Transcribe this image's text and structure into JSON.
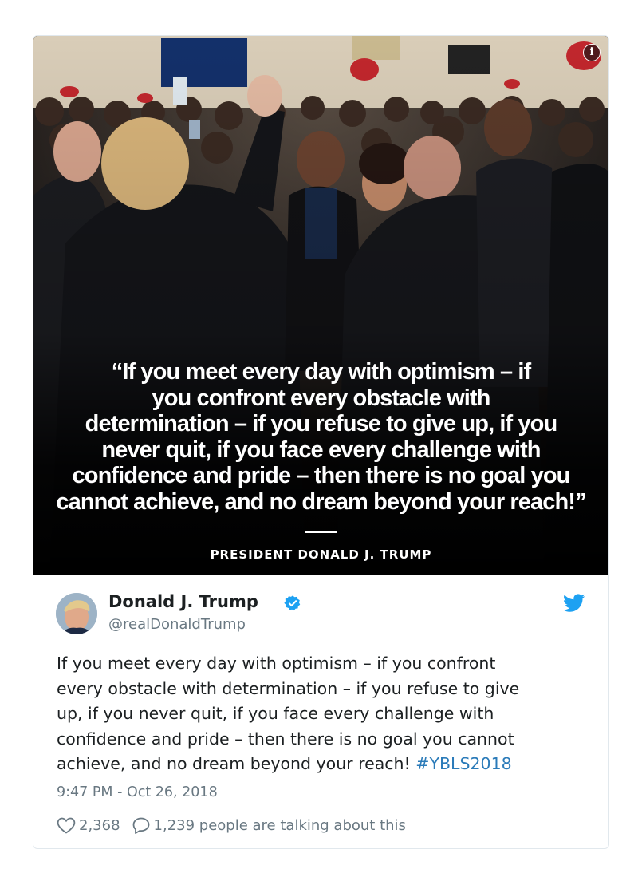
{
  "media": {
    "quote_lines": [
      "“If you meet every day with optimism – if",
      "you confront every obstacle with",
      "determination – if you refuse to give up, if you",
      "never quit, if you face every challenge with",
      "confidence and pride – then there is no goal you",
      "cannot achieve, and no dream beyond your reach!”"
    ],
    "attribution": "PRESIDENT DONALD J. TRUMP",
    "info_icon_glyph": "i"
  },
  "tweet": {
    "display_name": "Donald J. Trump",
    "handle": "@realDonaldTrump",
    "text_lines": [
      "If you meet every day with optimism – if you confront",
      "every obstacle with determination – if you refuse to give",
      "up, if you never quit, if you face every challenge with",
      "confidence and pride – then there is no goal you cannot"
    ],
    "last_line_text": "achieve, and no dream beyond your reach! ",
    "hashtag": "#YBLS2018",
    "timestamp": "9:47 PM - Oct 26, 2018",
    "likes": "2,368",
    "replies_text": "1,239 people are talking about this"
  },
  "icons": {
    "verified": "verified-badge-icon",
    "bird": "twitter-bird-icon",
    "heart": "heart-icon",
    "reply": "reply-bubble-icon",
    "info": "info-icon"
  },
  "colors": {
    "brand_blue": "#1da1f2",
    "hashtag_blue": "#2b7bb9",
    "muted_gray": "#697882",
    "text_dark": "#1c2022"
  }
}
